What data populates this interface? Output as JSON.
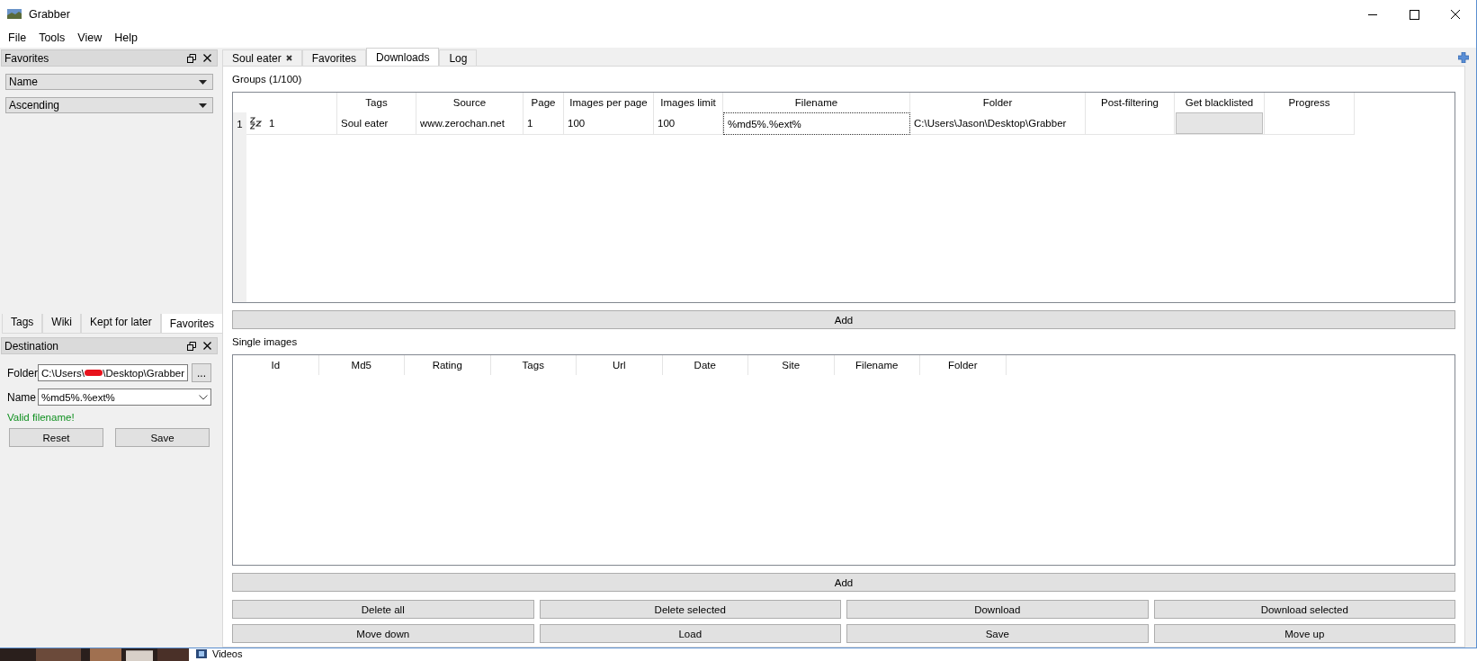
{
  "window": {
    "title": "Grabber"
  },
  "menu": [
    "File",
    "Tools",
    "View",
    "Help"
  ],
  "favorites_dock": {
    "title": "Favorites",
    "sort_by": "Name",
    "order": "Ascending"
  },
  "left_tabs": [
    {
      "label": "Tags",
      "selected": false
    },
    {
      "label": "Wiki",
      "selected": false
    },
    {
      "label": "Kept for later",
      "selected": false
    },
    {
      "label": "Favorites",
      "selected": true
    }
  ],
  "destination_dock": {
    "title": "Destination",
    "folder_label": "Folder",
    "folder_value_start": "C:\\Users\\",
    "folder_value_end": "\\Desktop\\Grabber",
    "browse_button": "...",
    "name_label": "Name",
    "name_value": "%md5%.%ext%",
    "validation": "Valid filename!",
    "buttons": [
      "Reset",
      "Save"
    ]
  },
  "tabs": [
    {
      "label": "Soul eater",
      "closable": true,
      "selected": false
    },
    {
      "label": "Favorites",
      "closable": false,
      "selected": false
    },
    {
      "label": "Downloads",
      "closable": false,
      "selected": true
    },
    {
      "label": "Log",
      "closable": false,
      "selected": false
    }
  ],
  "groups": {
    "title": "Groups (1/100)",
    "columns": [
      "",
      "Tags",
      "Source",
      "Page",
      "Images per page",
      "Images limit",
      "Filename",
      "Folder",
      "Post-filtering",
      "Get blacklisted",
      "Progress"
    ],
    "rows": [
      {
        "number": "1",
        "cells": [
          {
            "kind": "status",
            "text": "1"
          },
          {
            "kind": "text",
            "text": "Soul eater"
          },
          {
            "kind": "text",
            "text": "www.zerochan.net"
          },
          {
            "kind": "text",
            "text": "1"
          },
          {
            "kind": "text",
            "text": "100"
          },
          {
            "kind": "text",
            "text": "100"
          },
          {
            "kind": "text",
            "text": "%md5%.%ext%",
            "focused": true
          },
          {
            "kind": "text",
            "text": "C:\\Users\\Jason\\Desktop\\Grabber"
          },
          {
            "kind": "empty"
          },
          {
            "kind": "toggle"
          },
          {
            "kind": "empty"
          }
        ]
      }
    ]
  },
  "add_group_button": "Add",
  "single_images": {
    "title": "Single images",
    "columns": [
      "Id",
      "Md5",
      "Rating",
      "Tags",
      "Url",
      "Date",
      "Site",
      "Filename",
      "Folder"
    ]
  },
  "add_single_button": "Add",
  "actions": [
    "Delete all",
    "Delete selected",
    "Download",
    "Download selected",
    "Move down",
    "Load",
    "Save",
    "Move up"
  ],
  "desktop": {
    "item": "Videos"
  }
}
